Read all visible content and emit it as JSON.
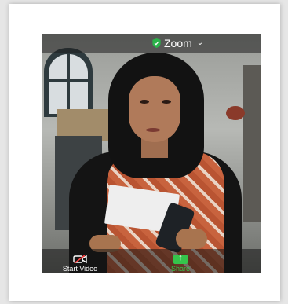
{
  "app": {
    "brand": "Zoom",
    "shield_color": "#2bb34a",
    "dropdown_icon": "chevron-down-icon"
  },
  "toolbar": {
    "start_video_label": "Start Video",
    "start_video_icon": "video-off-icon",
    "share_label": "Share",
    "share_icon": "share-up-arrow-icon",
    "share_color": "#35c44b"
  }
}
